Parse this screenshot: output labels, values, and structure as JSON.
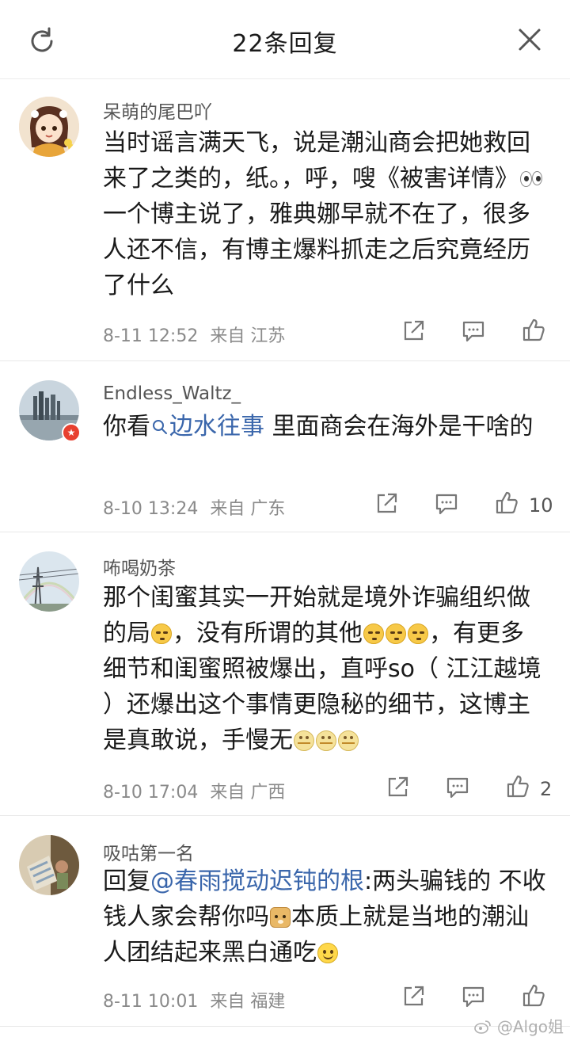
{
  "header": {
    "title": "22条回复",
    "refresh_icon": "refresh-icon",
    "close_icon": "close-icon"
  },
  "comments": [
    {
      "username": "呆萌的尾巴吖",
      "text_segments": [
        "当时谣言满天飞，说是潮汕商会把她救回来了之类的，纸。，呼，嗖《被害详情》",
        "一个博主说了，雅典娜早就不在了，很多人还不信，有博主爆料抓走之后究竟经历了什么"
      ],
      "time": "8-11 12:52",
      "from": "来自 江苏",
      "likes": ""
    },
    {
      "username": "Endless_Waltz_",
      "text_prefix": "你看",
      "text_link": "边水往事",
      "text_suffix": " 里面商会在海外是干啥的",
      "time": "8-10 13:24",
      "from": "来自 广东",
      "likes": "10"
    },
    {
      "username": "咘喝奶茶",
      "text_segments": [
        "那个闺蜜其实一开始就是境外诈骗组织做的局",
        "，没有所谓的其他",
        "，有更多细节和闺蜜照被爆出，直呼so（ 江江越境 ）还爆出这个事情更隐秘的细节，这博主是真敢说，手慢无"
      ],
      "time": "8-10 17:04",
      "from": "来自 广西",
      "likes": "2"
    },
    {
      "username": "吸咕第一名",
      "text_prefix": "回复",
      "text_link": "@春雨搅动迟钝的根",
      "text_segments": [
        ":两头骗钱的 不收钱人家会帮你吗",
        "本质上就是当地的潮汕人团结起来黑白通吃"
      ],
      "time": "8-11 10:01",
      "from": "来自 福建",
      "likes": ""
    }
  ],
  "watermark": "@Algo姐"
}
